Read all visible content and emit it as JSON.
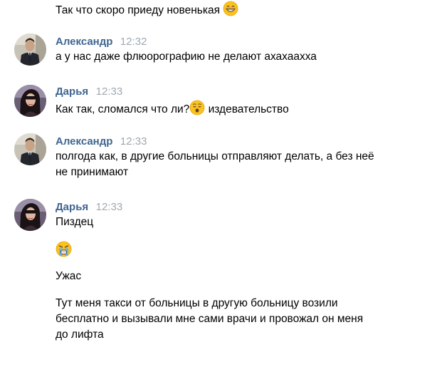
{
  "messages": {
    "m0": {
      "text": "Так что скоро приеду новенькая"
    },
    "m1": {
      "author": "Александр",
      "time": "12:32",
      "text": "а у нас даже флюорографию не делают ахахаахха"
    },
    "m2": {
      "author": "Дарья",
      "time": "12:33",
      "text_a": "Как так, сломался что ли?",
      "text_b": " издевательство"
    },
    "m3": {
      "author": "Александр",
      "time": "12:33",
      "text_line1": "полгода как, в другие больницы отправляют делать, а без неё",
      "text_line2": "не принимают"
    },
    "m4": {
      "author": "Дарья",
      "time": "12:33",
      "text_1": "Пиздец",
      "text_3": "Ужас",
      "text_4_line1": "Тут меня такси от больницы в другую больницу возили",
      "text_4_line2": "бесплатно и вызывали мне сами врачи и провожал он меня",
      "text_4_line3": "до лифта"
    }
  },
  "icons": {
    "grin": "grinning-face-emoji",
    "hushed": "hushed-face-emoji",
    "tears": "face-screaming-tears-emoji",
    "avatar_alexander": "avatar-alexander",
    "avatar_darya": "avatar-darya"
  },
  "colors": {
    "author": "#3f6591",
    "time": "#a0a8b1",
    "text": "#000000",
    "background": "#ffffff"
  }
}
